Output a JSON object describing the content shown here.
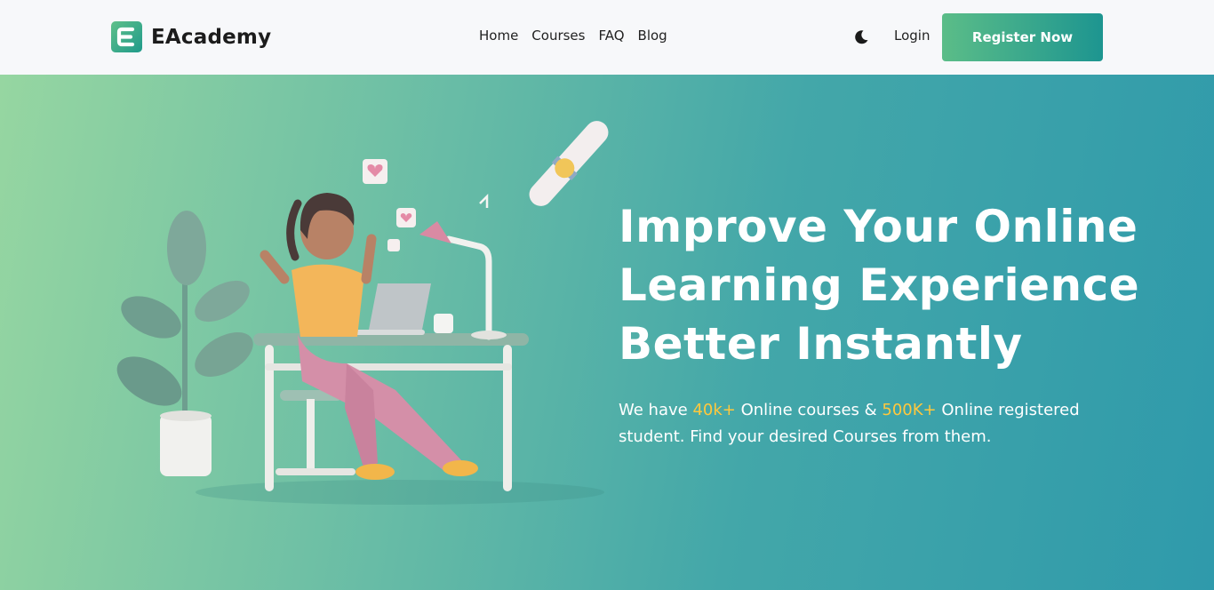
{
  "brand": {
    "name": "EAcademy",
    "logo_icon": "e-letter-logo",
    "accent": "#1d9590"
  },
  "nav": {
    "items": [
      "Home",
      "Courses",
      "FAQ",
      "Blog"
    ]
  },
  "header": {
    "theme_icon": "moon-icon",
    "login_label": "Login",
    "register_label": "Register Now"
  },
  "hero": {
    "title_lines": [
      "Improve Your Online",
      "Learning Experience",
      "Better Instantly"
    ],
    "desc_prefix": "We have ",
    "courses_count": "40k+",
    "desc_middle": " Online courses & ",
    "students_count": "500K+",
    "desc_suffix": " Online registered student. Find your desired Courses from them.",
    "highlight_color": "#ffc83d"
  }
}
